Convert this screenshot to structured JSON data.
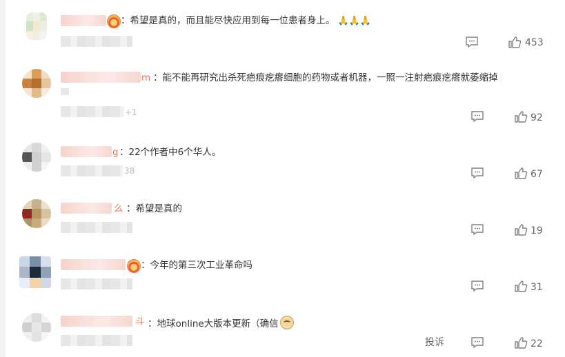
{
  "comments": [
    {
      "prefix": "",
      "text": "：希望是真的，而且能尽快应用到每一位患者身上。",
      "emoji": "🙏🙏🙏",
      "likes": "453"
    },
    {
      "prefix": "m",
      "text": "：能不能再研究出杀死疤痕疙瘩细胞的药物或者机器，一照一注射疤痕疙瘩就萎缩掉",
      "meta_tail": "+1",
      "likes": "92"
    },
    {
      "prefix": "g",
      "text": "：22个作者中6个华人。",
      "meta_tail": "38",
      "likes": "67"
    },
    {
      "prefix": "么",
      "text": "：希望是真的",
      "likes": "19"
    },
    {
      "prefix": "",
      "text": "：今年的第三次工业革命吗",
      "likes": "31"
    },
    {
      "prefix": "斗",
      "text": "：地球online大版本更新（确信",
      "report": "投诉",
      "likes": "22"
    }
  ],
  "icons": {
    "reply": "comment-reply-icon",
    "like": "thumbs-up-icon",
    "crown": "vip-crown-icon",
    "doge": "doge-emoji-icon",
    "pray": "pray-emoji-icon"
  },
  "colors": {
    "text": "#333333",
    "name_accent": "#eb7350",
    "icon": "#808080"
  }
}
